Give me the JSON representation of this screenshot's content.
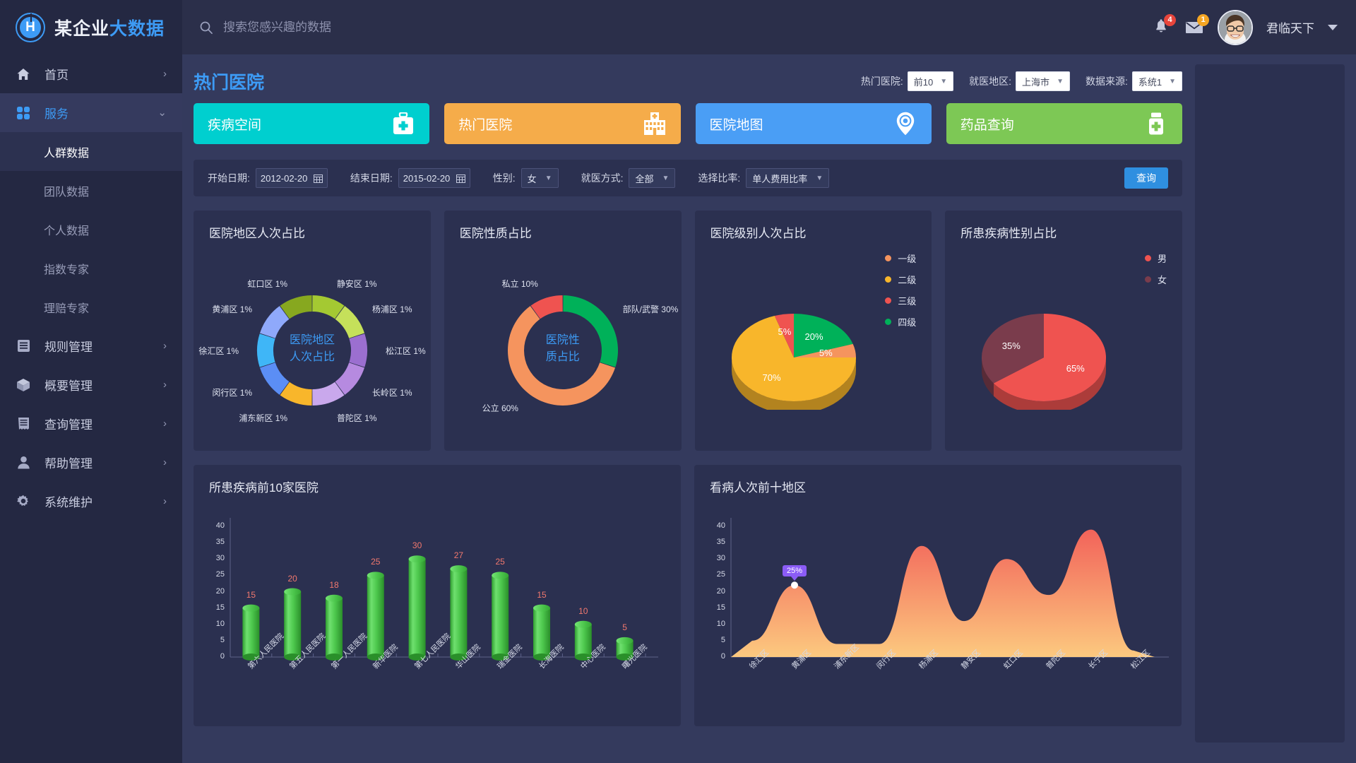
{
  "brand": {
    "name_dark": "某企业",
    "name_accent": "大数据",
    "logo_letter": "H"
  },
  "search": {
    "placeholder": "搜索您感兴趣的数据",
    "value": ""
  },
  "header": {
    "bell_badge": "4",
    "mail_badge": "1",
    "username": "君临天下"
  },
  "sidebar": {
    "items": [
      {
        "label": "首页",
        "icon": "home-icon",
        "chevron": "›",
        "active": false
      },
      {
        "label": "服务",
        "icon": "grid-icon",
        "chevron": "⌄",
        "active": true
      },
      {
        "label": "规则管理",
        "icon": "list-icon",
        "chevron": "›",
        "active": false
      },
      {
        "label": "概要管理",
        "icon": "cube-icon",
        "chevron": "›",
        "active": false
      },
      {
        "label": "查询管理",
        "icon": "document-icon",
        "chevron": "›",
        "active": false
      },
      {
        "label": "帮助管理",
        "icon": "user-icon",
        "chevron": "›",
        "active": false
      },
      {
        "label": "系统维护",
        "icon": "gear-icon",
        "chevron": "›",
        "active": false
      }
    ],
    "sub_items": [
      {
        "label": "人群数据",
        "active": true
      },
      {
        "label": "团队数据",
        "active": false
      },
      {
        "label": "个人数据",
        "active": false
      },
      {
        "label": "指数专家",
        "active": false
      },
      {
        "label": "理赔专家",
        "active": false
      }
    ]
  },
  "page": {
    "title": "热门医院",
    "head_filters": [
      {
        "label": "热门医院:",
        "value": "前10"
      },
      {
        "label": "就医地区:",
        "value": "上海市"
      },
      {
        "label": "数据来源:",
        "value": "系统1"
      }
    ],
    "cards": [
      {
        "label": "疾病空间",
        "icon": "medkit-icon",
        "color": "#00cfcf"
      },
      {
        "label": "热门医院",
        "icon": "hospital-icon",
        "color": "#f5ac4a"
      },
      {
        "label": "医院地图",
        "icon": "map-pin-icon",
        "color": "#4a9ef5"
      },
      {
        "label": "药品查询",
        "icon": "medicine-bottle-icon",
        "color": "#7dc855"
      }
    ],
    "filters": {
      "start_date_label": "开始日期:",
      "start_date_value": "2012-02-20",
      "end_date_label": "结束日期:",
      "end_date_value": "2015-02-20",
      "gender_label": "性别:",
      "gender_value": "女",
      "visit_label": "就医方式:",
      "visit_value": "全部",
      "ratio_label": "选择比率:",
      "ratio_value": "单人费用比率",
      "query_button": "查询"
    }
  },
  "chart_data": [
    {
      "type": "pie",
      "variant": "donut",
      "title": "医院地区人次占比",
      "center_line1": "医院地区",
      "center_line2": "人次占比",
      "labels": [
        "静安区",
        "杨浦区",
        "松江区",
        "长岭区",
        "普陀区",
        "浦东新区",
        "闵行区",
        "徐汇区",
        "黄浦区",
        "虹口区"
      ],
      "values": [
        1,
        1,
        1,
        1,
        1,
        1,
        1,
        1,
        1,
        1
      ],
      "value_suffix": "%",
      "colors": [
        "#a4c932",
        "#c5e05a",
        "#9b6fd0",
        "#b68ae0",
        "#c9a8ec",
        "#f8b62b",
        "#5b8ef5",
        "#3fb6f7",
        "#8fa9fb",
        "#87a81f"
      ],
      "legend": false
    },
    {
      "type": "pie",
      "variant": "donut",
      "title": "医院性质占比",
      "center_line1": "医院性",
      "center_line2": "质占比",
      "labels": [
        "部队/武警",
        "公立",
        "私立"
      ],
      "values": [
        30,
        60,
        10
      ],
      "value_suffix": "%",
      "colors": [
        "#00b159",
        "#f5945e",
        "#ef5350"
      ],
      "legend": false
    },
    {
      "type": "pie",
      "variant": "pie3d",
      "title": "医院级别人次占比",
      "labels": [
        "四级",
        "一级",
        "二级",
        "三级"
      ],
      "values": [
        20,
        5,
        70,
        5
      ],
      "value_suffix": "%",
      "legend_order": [
        "一级",
        "二级",
        "三级",
        "四级"
      ],
      "legend_colors": [
        "#f5945e",
        "#f8b62b",
        "#ef5350",
        "#00b159"
      ],
      "colors": [
        "#00b159",
        "#f5945e",
        "#f8b62b",
        "#ef5350"
      ],
      "legend": true,
      "legend_position": "top-right"
    },
    {
      "type": "pie",
      "variant": "pie3d",
      "title": "所患疾病性别占比",
      "labels": [
        "男",
        "女"
      ],
      "values": [
        65,
        35
      ],
      "value_suffix": "%",
      "legend_order": [
        "男",
        "女"
      ],
      "legend_colors": [
        "#ef5350",
        "#7a3c4c"
      ],
      "colors": [
        "#ef5350",
        "#7a3c4c"
      ],
      "legend": true,
      "legend_position": "top-right"
    },
    {
      "type": "bar",
      "title": "所患疾病前10家医院",
      "categories": [
        "第六人民医院",
        "第五人民医院",
        "第一人民医院",
        "新华医院",
        "第七人民医院",
        "华山医院",
        "瑞金医院",
        "长海医院",
        "中心医院",
        "曙光医院"
      ],
      "values": [
        15,
        20,
        18,
        25,
        30,
        27,
        25,
        15,
        10,
        5
      ],
      "ylim": [
        0,
        40
      ],
      "yticks": [
        0,
        5,
        10,
        15,
        20,
        25,
        30,
        35,
        40
      ],
      "xlabel": "",
      "ylabel": "",
      "bar_color": "#4ec94e",
      "label_color": "#f2786e"
    },
    {
      "type": "area",
      "title": "看病人次前十地区",
      "categories": [
        "徐汇区",
        "黄浦区",
        "浦东新区",
        "闵行区",
        "杨浦区",
        "静安区",
        "虹口区",
        "普陀区",
        "长宁区",
        "松江区"
      ],
      "values": [
        5,
        22,
        4,
        4,
        34,
        11,
        30,
        19,
        39,
        2
      ],
      "ylim": [
        0,
        40
      ],
      "yticks": [
        0,
        5,
        10,
        15,
        20,
        25,
        30,
        35,
        40
      ],
      "tooltip": {
        "text": "25%",
        "category": "黄浦区"
      },
      "gradient_top": "#f2635a",
      "gradient_bottom": "#fcc97f"
    }
  ]
}
